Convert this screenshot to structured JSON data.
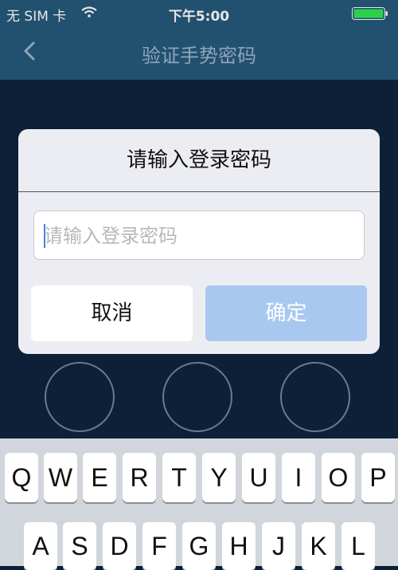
{
  "status": {
    "carrier": "无 SIM 卡",
    "time": "下午5:00"
  },
  "nav": {
    "title": "验证手势密码",
    "back_icon": "chevron-left-icon"
  },
  "dialog": {
    "title": "请输入登录密码",
    "input_placeholder": "请输入登录密码",
    "input_value": "",
    "cancel_label": "取消",
    "confirm_label": "确定"
  },
  "keyboard": {
    "row1": [
      "Q",
      "W",
      "E",
      "R",
      "T",
      "Y",
      "U",
      "I",
      "O",
      "P"
    ],
    "row2": [
      "A",
      "S",
      "D",
      "F",
      "G",
      "H",
      "J",
      "K",
      "L"
    ]
  },
  "colors": {
    "nav_bg": "#22506f",
    "page_bg": "#0d2038",
    "dialog_bg": "#ecedf3",
    "confirm_bg": "#a9c8ef",
    "battery_green": "#2bd14a"
  }
}
